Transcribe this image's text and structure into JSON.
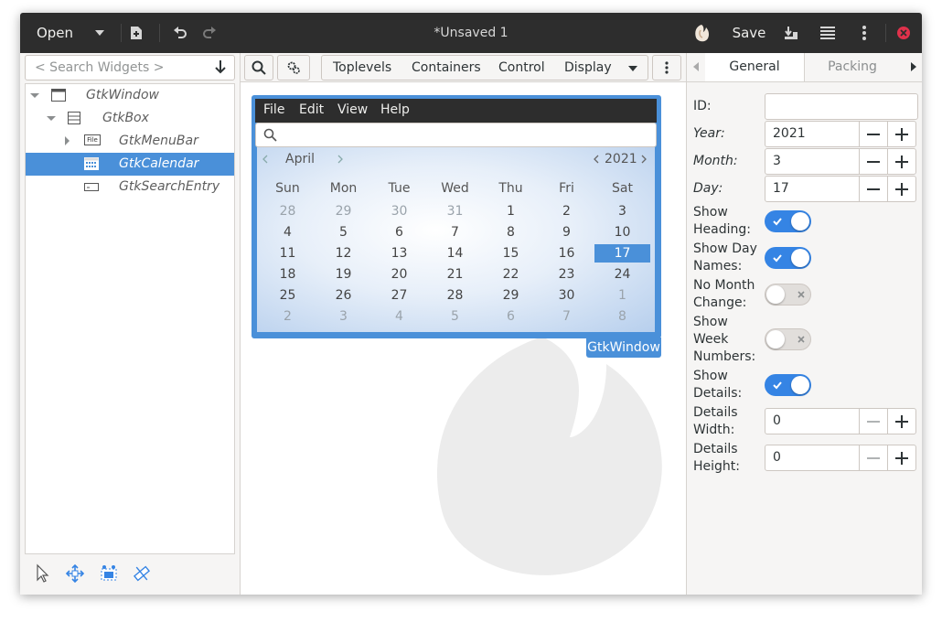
{
  "header": {
    "open_label": "Open",
    "title": "*Unsaved 1",
    "save_label": "Save"
  },
  "left": {
    "search_placeholder": "< Search Widgets >",
    "tree": [
      {
        "label": "GtkWindow"
      },
      {
        "label": "GtkBox"
      },
      {
        "label": "GtkMenuBar",
        "icon_text": "File"
      },
      {
        "label": "GtkCalendar"
      },
      {
        "label": "GtkSearchEntry"
      }
    ]
  },
  "palette": {
    "tabs": [
      "Toplevels",
      "Containers",
      "Control",
      "Display"
    ]
  },
  "preview": {
    "menu": [
      "File",
      "Edit",
      "View",
      "Help"
    ],
    "calendar": {
      "month": "April",
      "year": "2021",
      "day_names": [
        "Sun",
        "Mon",
        "Tue",
        "Wed",
        "Thu",
        "Fri",
        "Sat"
      ],
      "weeks": [
        [
          "28",
          "29",
          "30",
          "31",
          "1",
          "2",
          "3"
        ],
        [
          "4",
          "5",
          "6",
          "7",
          "8",
          "9",
          "10"
        ],
        [
          "11",
          "12",
          "13",
          "14",
          "15",
          "16",
          "17"
        ],
        [
          "18",
          "19",
          "20",
          "21",
          "22",
          "23",
          "24"
        ],
        [
          "25",
          "26",
          "27",
          "28",
          "29",
          "30",
          "1"
        ],
        [
          "2",
          "3",
          "4",
          "5",
          "6",
          "7",
          "8"
        ]
      ],
      "selected_day": "17"
    },
    "window_label": "GtkWindow"
  },
  "props": {
    "tabs": [
      "General",
      "Packing"
    ],
    "id_label": "ID:",
    "id_value": "",
    "year_label": "Year:",
    "year_value": "2021",
    "month_label": "Month:",
    "month_value": "3",
    "day_label": "Day:",
    "day_value": "17",
    "show_heading_label": "Show Heading:",
    "show_heading": true,
    "show_day_names_label": "Show Day Names:",
    "show_day_names": true,
    "no_month_change_label": "No Month Change:",
    "no_month_change": false,
    "show_week_numbers_label": "Show Week Numbers:",
    "show_week_numbers": false,
    "show_details_label": "Show Details:",
    "show_details": true,
    "details_width_label": "Details Width:",
    "details_width_value": "0",
    "details_height_label": "Details Height:",
    "details_height_value": "0"
  },
  "colors": {
    "accent": "#4a90d9",
    "titlebar": "#2d2d2d",
    "close": "#e0314b"
  }
}
